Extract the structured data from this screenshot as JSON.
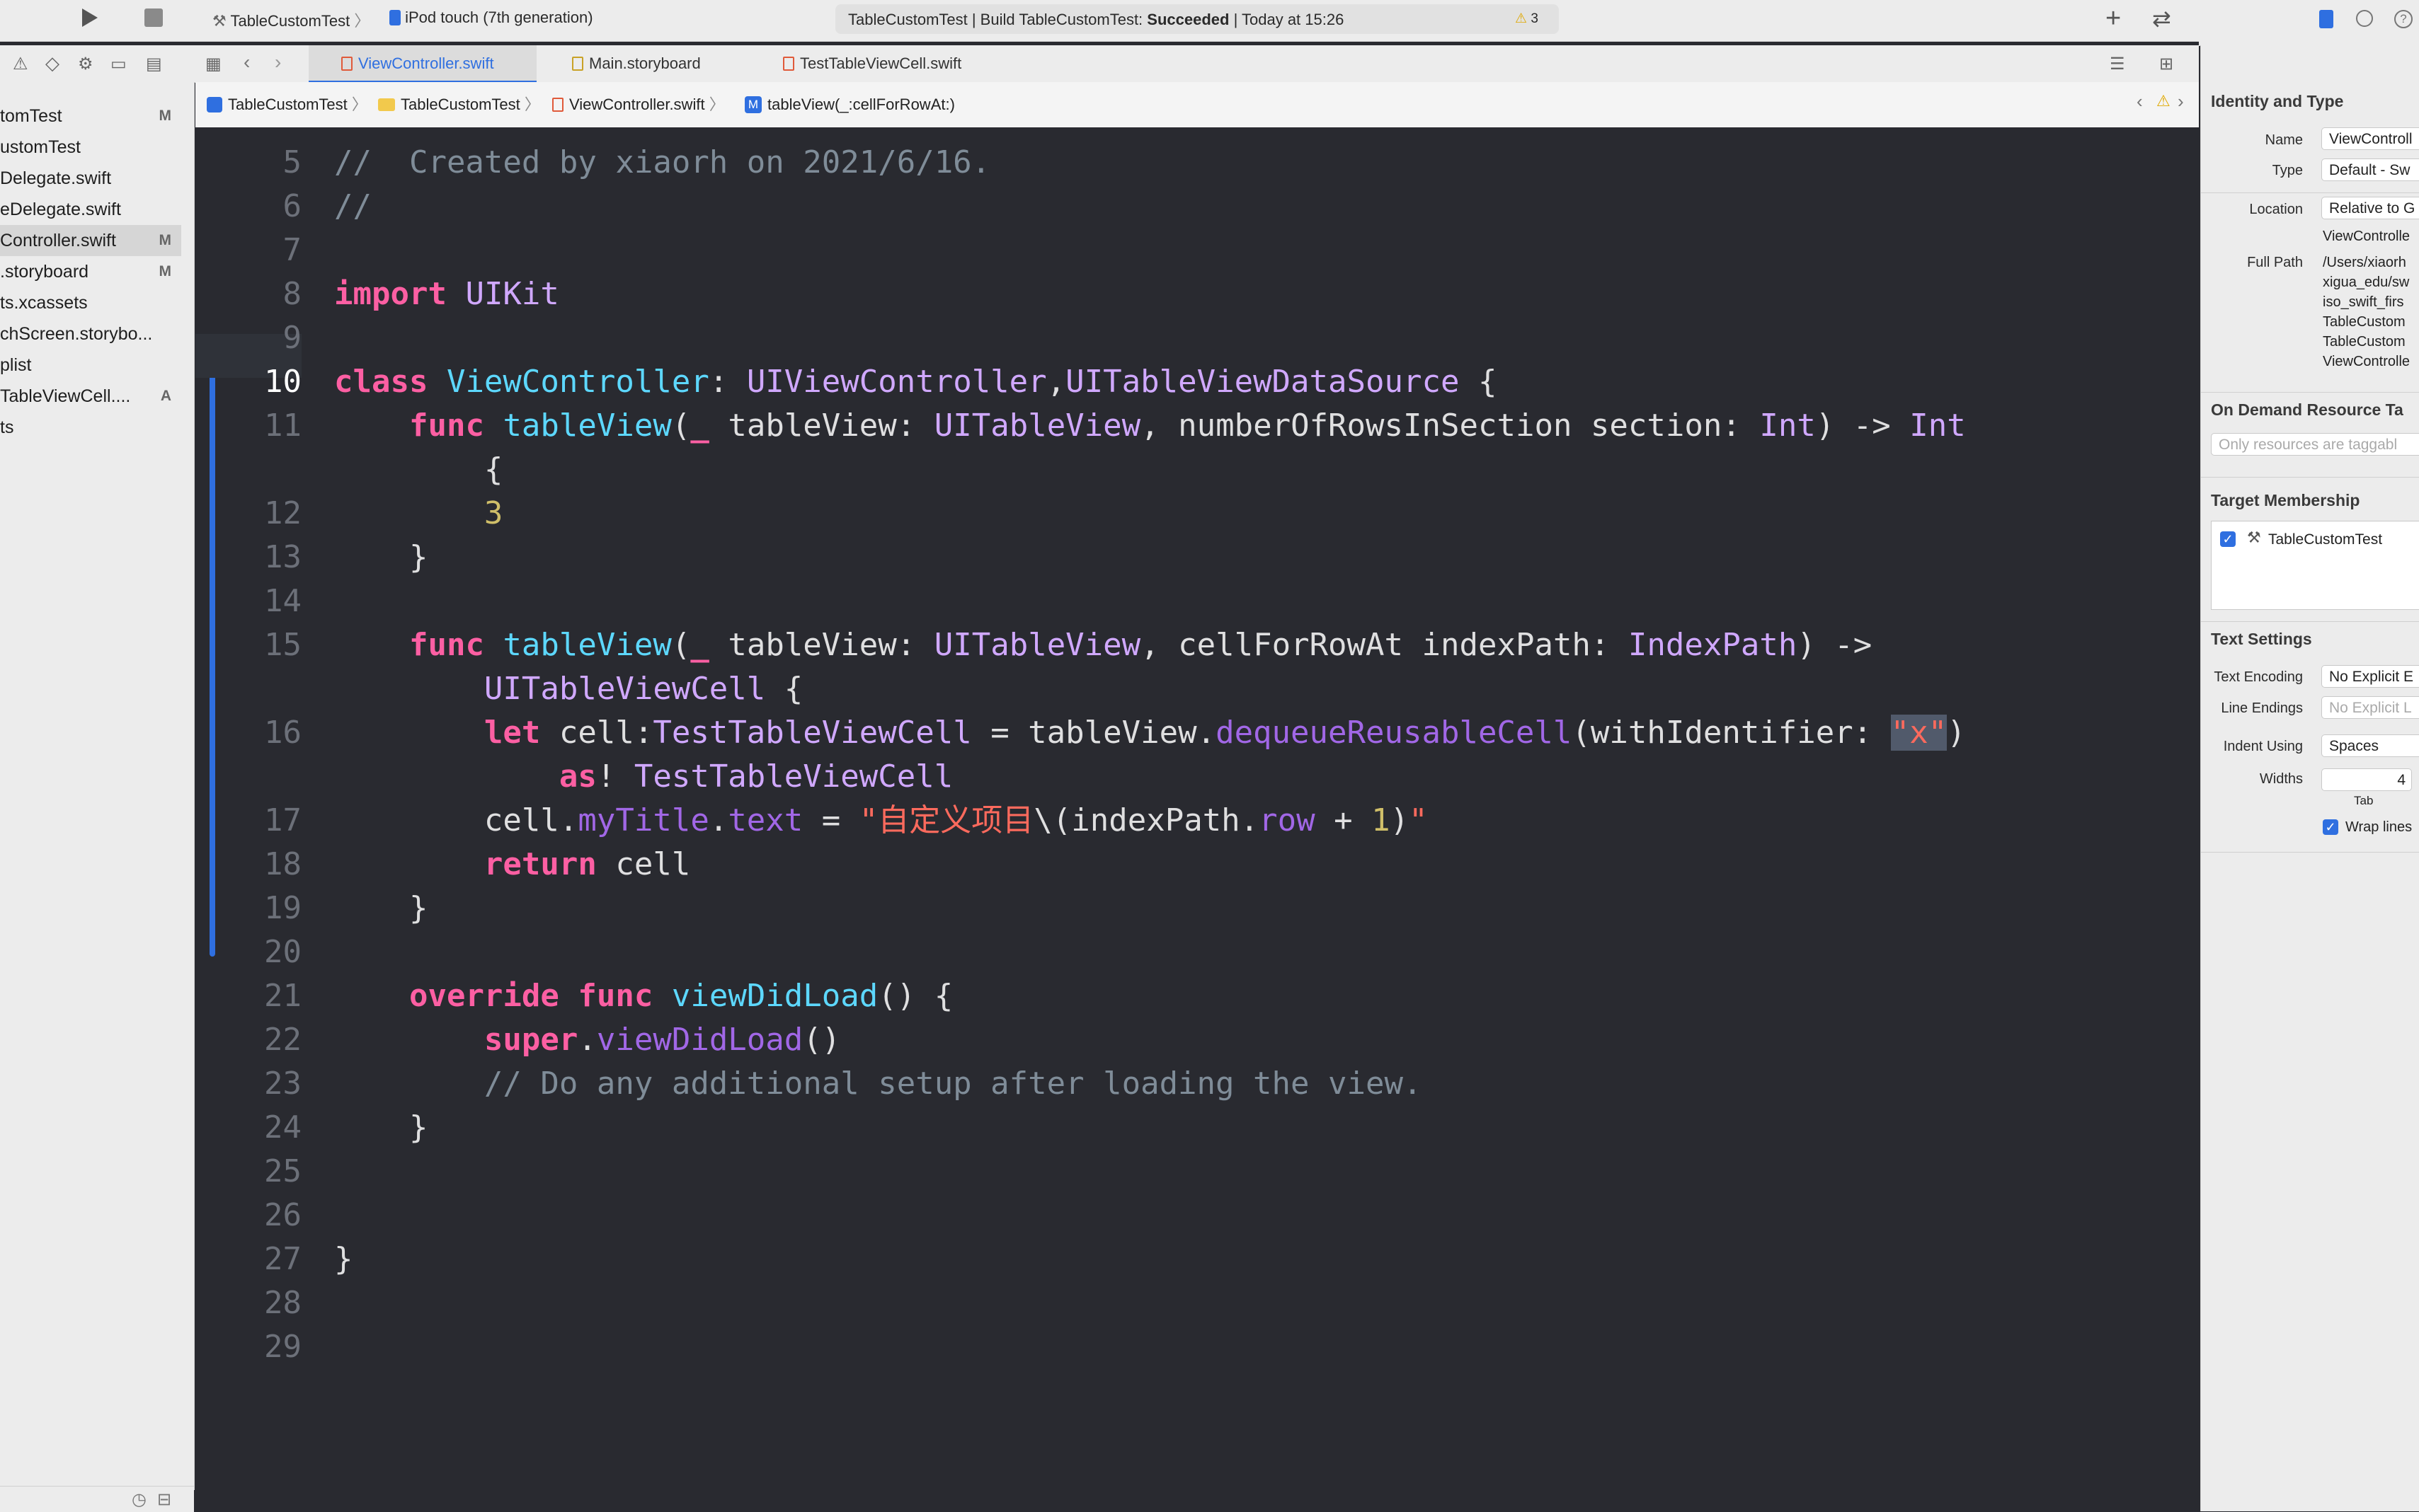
{
  "toolbar": {
    "scheme": "TableCustomTest",
    "device": "iPod touch (7th generation)",
    "status_prefix": "TableCustomTest | Build TableCustomTest: ",
    "status_result": "Succeeded",
    "status_suffix": " | Today at 15:26",
    "warning_count": "3"
  },
  "tabs": [
    {
      "label": "ViewController.swift"
    },
    {
      "label": "Main.storyboard"
    },
    {
      "label": "TestTableViewCell.swift"
    }
  ],
  "jumpbar": {
    "project": "TableCustomTest",
    "group": "TableCustomTest",
    "file": "ViewController.swift",
    "method_badge": "M",
    "method": "tableView(_:cellForRowAt:)"
  },
  "navigator": {
    "items": [
      {
        "label": "tomTest",
        "badge": "M"
      },
      {
        "label": "ustomTest",
        "badge": ""
      },
      {
        "label": "Delegate.swift",
        "badge": ""
      },
      {
        "label": "eDelegate.swift",
        "badge": ""
      },
      {
        "label": "Controller.swift",
        "badge": "M"
      },
      {
        "label": ".storyboard",
        "badge": "M"
      },
      {
        "label": "ts.xcassets",
        "badge": ""
      },
      {
        "label": "chScreen.storybo...",
        "badge": ""
      },
      {
        "label": "plist",
        "badge": ""
      },
      {
        "label": "TableViewCell....",
        "badge": "A"
      },
      {
        "label": "ts",
        "badge": ""
      }
    ]
  },
  "editor": {
    "lines": [
      {
        "num": "5",
        "code": "//  Created by xiaorh on 2021/6/16."
      },
      {
        "num": "6",
        "code": "//"
      },
      {
        "num": "7",
        "code": ""
      },
      {
        "num": "8",
        "code": "import UIKit"
      },
      {
        "num": "9",
        "code": ""
      },
      {
        "num": "10",
        "code": "class ViewController: UIViewController,UITableViewDataSource {"
      },
      {
        "num": "11",
        "code": "    func tableView(_ tableView: UITableView, numberOfRowsInSection section: Int) -> Int"
      },
      {
        "num": "",
        "code": "        {"
      },
      {
        "num": "12",
        "code": "        3"
      },
      {
        "num": "13",
        "code": "    }"
      },
      {
        "num": "14",
        "code": ""
      },
      {
        "num": "15",
        "code": "    func tableView(_ tableView: UITableView, cellForRowAt indexPath: IndexPath) ->"
      },
      {
        "num": "",
        "code": "        UITableViewCell {"
      },
      {
        "num": "16",
        "code": "        let cell:TestTableViewCell = tableView.dequeueReusableCell(withIdentifier: \"x\")"
      },
      {
        "num": "",
        "code": "            as! TestTableViewCell"
      },
      {
        "num": "17",
        "code": "        cell.myTitle.text = \"自定义项目\\(indexPath.row + 1)\""
      },
      {
        "num": "18",
        "code": "        return cell"
      },
      {
        "num": "19",
        "code": "    }"
      },
      {
        "num": "20",
        "code": ""
      },
      {
        "num": "21",
        "code": "    override func viewDidLoad() {"
      },
      {
        "num": "22",
        "code": "        super.viewDidLoad()"
      },
      {
        "num": "23",
        "code": "        // Do any additional setup after loading the view."
      },
      {
        "num": "24",
        "code": "    }"
      },
      {
        "num": "25",
        "code": ""
      },
      {
        "num": "26",
        "code": ""
      },
      {
        "num": "27",
        "code": "}"
      },
      {
        "num": "28",
        "code": ""
      },
      {
        "num": "29",
        "code": ""
      }
    ]
  },
  "inspector": {
    "identity_title": "Identity and Type",
    "name_label": "Name",
    "name_value": "ViewControll",
    "type_label": "Type",
    "type_value": "Default - Sw",
    "location_label": "Location",
    "location_value": "Relative to G",
    "location_file": "ViewControlle",
    "fullpath_label": "Full Path",
    "fullpath_lines": [
      "/Users/xiaorh",
      "xigua_edu/sw",
      "iso_swift_firs",
      "TableCustom",
      "TableCustom",
      "ViewControlle"
    ],
    "ondemand_title": "On Demand Resource Ta",
    "ondemand_placeholder": "Only resources are taggabl",
    "target_title": "Target Membership",
    "target_item": "TableCustomTest",
    "text_settings_title": "Text Settings",
    "encoding_label": "Text Encoding",
    "encoding_value": "No Explicit E",
    "line_endings_label": "Line Endings",
    "line_endings_value": "No Explicit L",
    "indent_label": "Indent Using",
    "indent_value": "Spaces",
    "widths_label": "Widths",
    "widths_value": "4",
    "tab_label": "Tab",
    "wrap_label": "Wrap lines"
  },
  "colors": {
    "editor_bg": "#292a30",
    "keyword": "#fc5fa3",
    "string": "#fc6a5d",
    "accent": "#2f6fe0"
  }
}
